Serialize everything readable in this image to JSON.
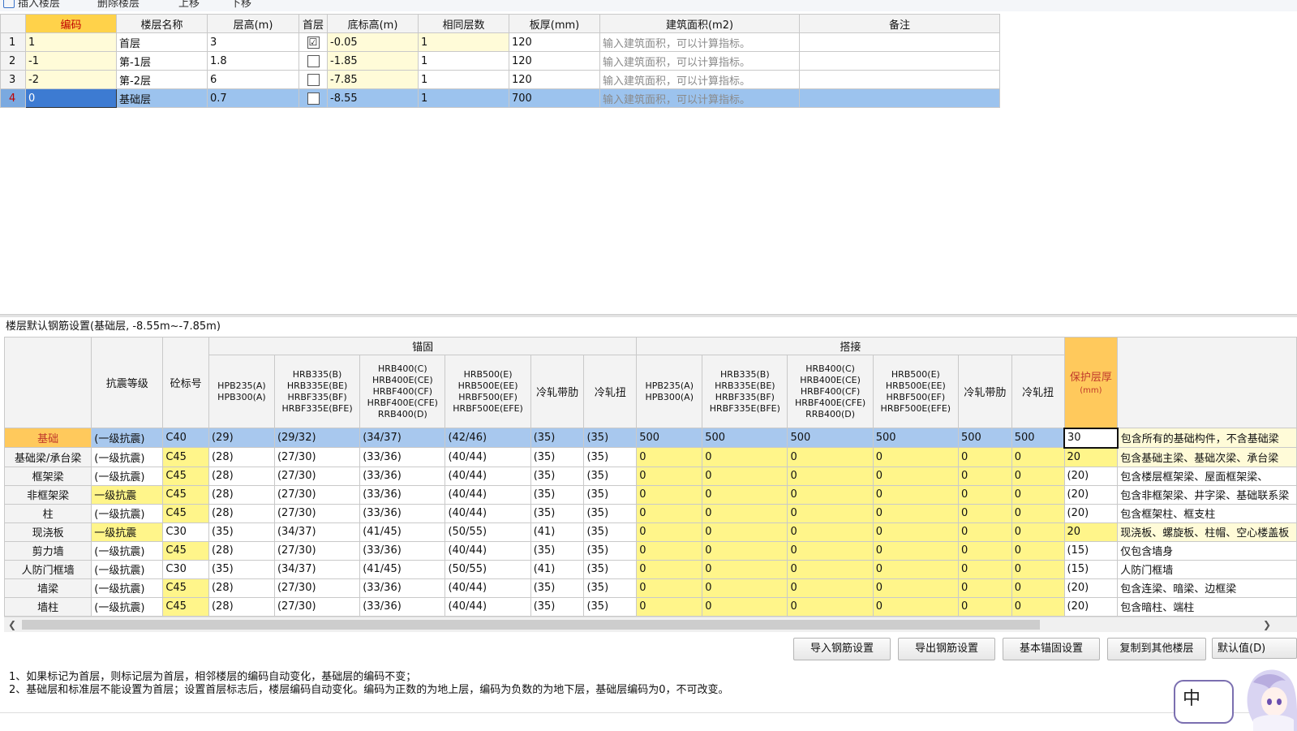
{
  "toolbar": {
    "items": [
      "插入楼层",
      "删除楼层",
      "上移",
      "下移"
    ]
  },
  "floor_table": {
    "headers": [
      "编码",
      "楼层名称",
      "层高(m)",
      "首层",
      "底标高(m)",
      "相同层数",
      "板厚(mm)",
      "建筑面积(m2)",
      "备注"
    ],
    "rows": [
      {
        "num": "1",
        "code": "1",
        "name": "首层",
        "height": "3",
        "first": "☑",
        "base": "-0.05",
        "same": "1",
        "thick": "120",
        "area": "输入建筑面积，可以计算指标。",
        "note": ""
      },
      {
        "num": "2",
        "code": "-1",
        "name": "第-1层",
        "height": "1.8",
        "first": "",
        "base": "-1.85",
        "same": "1",
        "thick": "120",
        "area": "输入建筑面积，可以计算指标。",
        "note": ""
      },
      {
        "num": "3",
        "code": "-2",
        "name": "第-2层",
        "height": "6",
        "first": "",
        "base": "-7.85",
        "same": "1",
        "thick": "120",
        "area": "输入建筑面积，可以计算指标。",
        "note": ""
      },
      {
        "num": "4",
        "code": "0",
        "name": "基础层",
        "height": "0.7",
        "first": "",
        "base": "-8.55",
        "same": "1",
        "thick": "700",
        "area": "输入建筑面积，可以计算指标。",
        "note": ""
      }
    ]
  },
  "section_title": "楼层默认钢筋设置(基础层, -8.55m~-7.85m)",
  "rebar_table": {
    "group_anchor": "锚固",
    "group_lap": "搭接",
    "headers": {
      "grade": "抗震等级",
      "concrete": "砼标号",
      "hpb": "HPB235(A) HPB300(A)",
      "hrb335": "HRB335(B) HRB335E(BE) HRBF335(BF) HRBF335E(BFE)",
      "hrb400": "HRB400(C) HRB400E(CE) HRBF400(CF) HRBF400E(CFE) RRB400(D)",
      "hrb500": "HRB500(E) HRB500E(EE) HRBF500(EF) HRBF500E(EFE)",
      "cold_rib": "冷轧带肋",
      "cold_twist": "冷轧扭",
      "cover": "保护层厚",
      "cover_unit": "(mm)"
    },
    "rows": [
      {
        "comp": "基础",
        "grade": "(一级抗震)",
        "conc": "C40",
        "a1": "(29)",
        "a2": "(29/32)",
        "a3": "(34/37)",
        "a4": "(42/46)",
        "a5": "(35)",
        "a6": "(35)",
        "l1": "500",
        "l2": "500",
        "l3": "500",
        "l4": "500",
        "l5": "500",
        "l6": "500",
        "cover": "30",
        "desc": "包含所有的基础构件，不含基础梁"
      },
      {
        "comp": "基础梁/承台梁",
        "grade": "(一级抗震)",
        "conc": "C45",
        "a1": "(28)",
        "a2": "(27/30)",
        "a3": "(33/36)",
        "a4": "(40/44)",
        "a5": "(35)",
        "a6": "(35)",
        "l1": "0",
        "l2": "0",
        "l3": "0",
        "l4": "0",
        "l5": "0",
        "l6": "0",
        "cover": "20",
        "desc": "包含基础主梁、基础次梁、承台梁"
      },
      {
        "comp": "框架梁",
        "grade": "(一级抗震)",
        "conc": "C45",
        "a1": "(28)",
        "a2": "(27/30)",
        "a3": "(33/36)",
        "a4": "(40/44)",
        "a5": "(35)",
        "a6": "(35)",
        "l1": "0",
        "l2": "0",
        "l3": "0",
        "l4": "0",
        "l5": "0",
        "l6": "0",
        "cover": "(20)",
        "desc": "包含楼层框架梁、屋面框架梁、"
      },
      {
        "comp": "非框架梁",
        "grade": "一级抗震",
        "conc": "C45",
        "a1": "(28)",
        "a2": "(27/30)",
        "a3": "(33/36)",
        "a4": "(40/44)",
        "a5": "(35)",
        "a6": "(35)",
        "l1": "0",
        "l2": "0",
        "l3": "0",
        "l4": "0",
        "l5": "0",
        "l6": "0",
        "cover": "(20)",
        "desc": "包含非框架梁、井字梁、基础联系梁"
      },
      {
        "comp": "柱",
        "grade": "(一级抗震)",
        "conc": "C45",
        "a1": "(28)",
        "a2": "(27/30)",
        "a3": "(33/36)",
        "a4": "(40/44)",
        "a5": "(35)",
        "a6": "(35)",
        "l1": "0",
        "l2": "0",
        "l3": "0",
        "l4": "0",
        "l5": "0",
        "l6": "0",
        "cover": "(20)",
        "desc": "包含框架柱、框支柱"
      },
      {
        "comp": "现浇板",
        "grade": "一级抗震",
        "conc": "C30",
        "a1": "(35)",
        "a2": "(34/37)",
        "a3": "(41/45)",
        "a4": "(50/55)",
        "a5": "(41)",
        "a6": "(35)",
        "l1": "0",
        "l2": "0",
        "l3": "0",
        "l4": "0",
        "l5": "0",
        "l6": "0",
        "cover": "20",
        "desc": "现浇板、螺旋板、柱帽、空心楼盖板"
      },
      {
        "comp": "剪力墙",
        "grade": "(一级抗震)",
        "conc": "C45",
        "a1": "(28)",
        "a2": "(27/30)",
        "a3": "(33/36)",
        "a4": "(40/44)",
        "a5": "(35)",
        "a6": "(35)",
        "l1": "0",
        "l2": "0",
        "l3": "0",
        "l4": "0",
        "l5": "0",
        "l6": "0",
        "cover": "(15)",
        "desc": "仅包含墙身"
      },
      {
        "comp": "人防门框墙",
        "grade": "(一级抗震)",
        "conc": "C30",
        "a1": "(35)",
        "a2": "(34/37)",
        "a3": "(41/45)",
        "a4": "(50/55)",
        "a5": "(41)",
        "a6": "(35)",
        "l1": "0",
        "l2": "0",
        "l3": "0",
        "l4": "0",
        "l5": "0",
        "l6": "0",
        "cover": "(15)",
        "desc": "人防门框墙"
      },
      {
        "comp": "墙梁",
        "grade": "(一级抗震)",
        "conc": "C45",
        "a1": "(28)",
        "a2": "(27/30)",
        "a3": "(33/36)",
        "a4": "(40/44)",
        "a5": "(35)",
        "a6": "(35)",
        "l1": "0",
        "l2": "0",
        "l3": "0",
        "l4": "0",
        "l5": "0",
        "l6": "0",
        "cover": "(20)",
        "desc": "包含连梁、暗梁、边框梁"
      },
      {
        "comp": "墙柱",
        "grade": "(一级抗震)",
        "conc": "C45",
        "a1": "(28)",
        "a2": "(27/30)",
        "a3": "(33/36)",
        "a4": "(40/44)",
        "a5": "(35)",
        "a6": "(35)",
        "l1": "0",
        "l2": "0",
        "l3": "0",
        "l4": "0",
        "l5": "0",
        "l6": "0",
        "cover": "(20)",
        "desc": "包含暗柱、端柱"
      }
    ]
  },
  "buttons": {
    "import": "导入钢筋设置",
    "export": "导出钢筋设置",
    "anchor": "基本锚固设置",
    "copy": "复制到其他楼层",
    "default": "默认值(D)"
  },
  "notes": [
    "1、如果标记为首层，则标记层为首层，相邻楼层的编码自动变化，基础层的编码不变；",
    "2、基础层和标准层不能设置为首层；设置首层标志后，楼层编码自动变化。编码为正数的为地上层，编码为负数的为地下层，基础层编码为0，不可改变。"
  ],
  "ime": {
    "label": "中"
  },
  "colors": {
    "accent": "#3d7bd2",
    "selected_row": "#9cc3ee",
    "yellow_cell": "#fff58a",
    "header_highlight": "#ffd24a"
  }
}
